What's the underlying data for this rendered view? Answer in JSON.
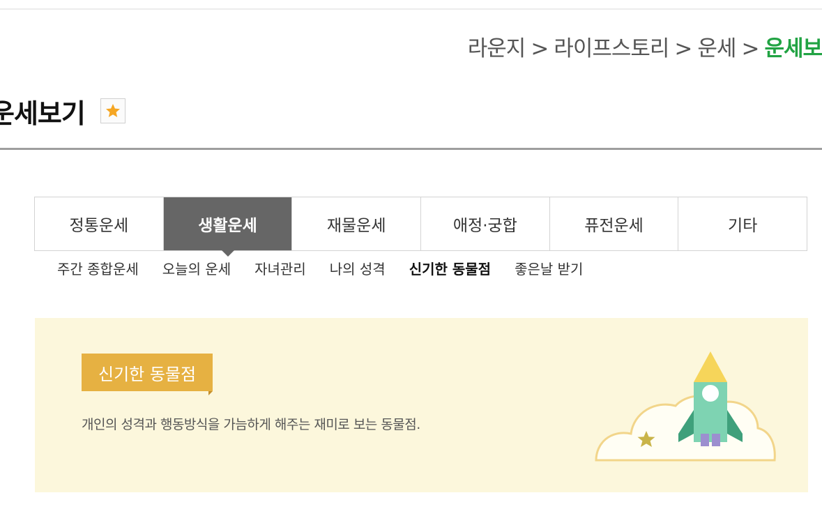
{
  "breadcrumb": {
    "items": [
      "라운지",
      "라이프스토리",
      "운세"
    ],
    "separator": ">",
    "current": "운세보"
  },
  "page": {
    "title": "운세보기"
  },
  "tabs": [
    {
      "label": "정통운세",
      "active": false
    },
    {
      "label": "생활운세",
      "active": true
    },
    {
      "label": "재물운세",
      "active": false
    },
    {
      "label": "애정·궁합",
      "active": false
    },
    {
      "label": "퓨전운세",
      "active": false
    },
    {
      "label": "기타",
      "active": false
    }
  ],
  "subnav": [
    {
      "label": "주간 종합운세",
      "active": false
    },
    {
      "label": "오늘의 운세",
      "active": false
    },
    {
      "label": "자녀관리",
      "active": false
    },
    {
      "label": "나의 성격",
      "active": false
    },
    {
      "label": "신기한 동물점",
      "active": true
    },
    {
      "label": "좋은날 받기",
      "active": false
    }
  ],
  "banner": {
    "badge": "신기한 동물점",
    "description": "개인의 성격과 행동방식을 가늠하게 해주는 재미로 보는 동물점."
  },
  "colors": {
    "accent_green": "#21a343",
    "active_tab": "#666666",
    "badge": "#e6b142",
    "banner_bg": "#fcf7dc",
    "star": "#f5a623"
  },
  "icons": {
    "favorite": "star-icon",
    "illustration": "rocket-cloud-illustration"
  }
}
